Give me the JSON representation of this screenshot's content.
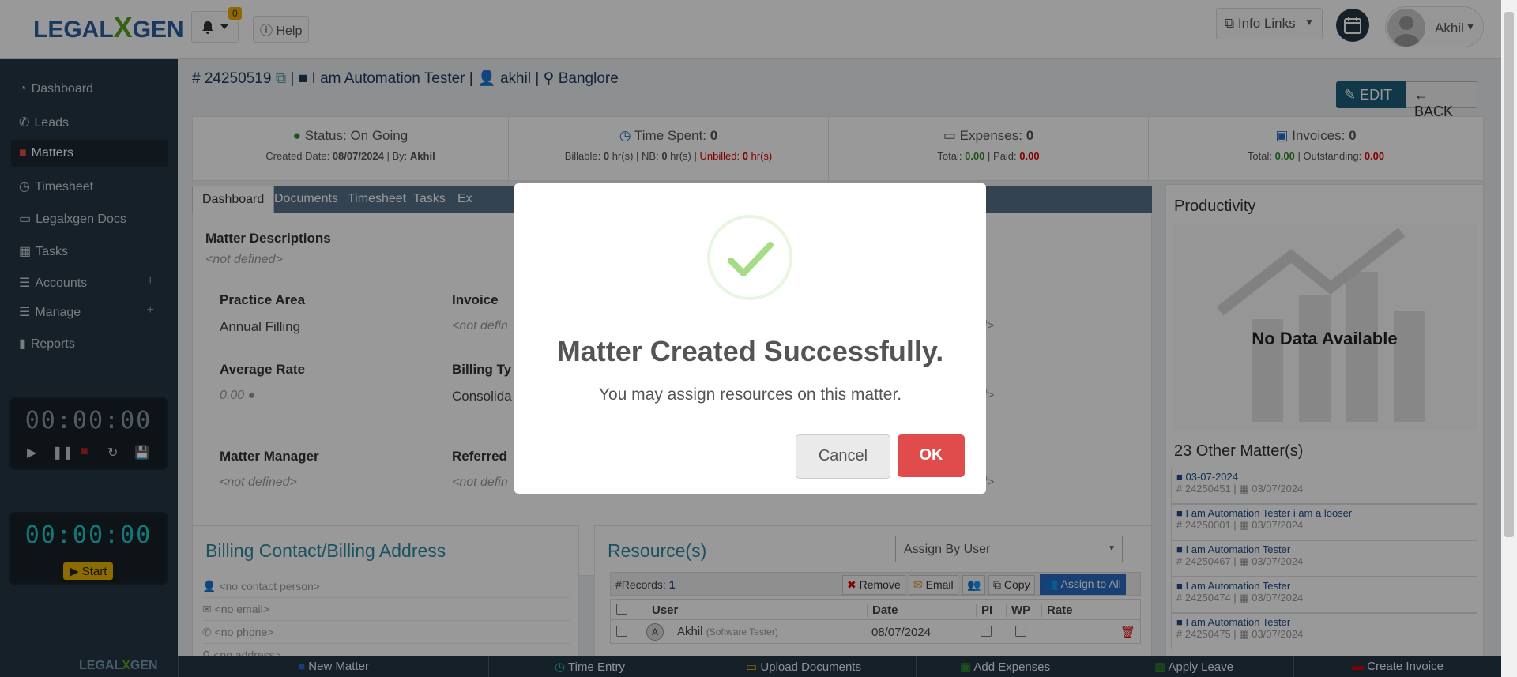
{
  "header": {
    "logo": {
      "left": "LEGAL",
      "mid": "X",
      "right": "GEN"
    },
    "notifications_count": "0",
    "help": "Help",
    "info_links": "Info Links",
    "user_name": "Akhil"
  },
  "sidebar": {
    "items": [
      {
        "label": "Dashboard",
        "icon": "dashboard-icon"
      },
      {
        "label": "Leads",
        "icon": "phone-icon"
      },
      {
        "label": "Matters",
        "icon": "briefcase-icon"
      },
      {
        "label": "Timesheet",
        "icon": "clock-icon"
      },
      {
        "label": "Legalxgen Docs",
        "icon": "folder-icon"
      },
      {
        "label": "Tasks",
        "icon": "calendar-icon"
      },
      {
        "label": "Accounts",
        "icon": "list-icon"
      },
      {
        "label": "Manage",
        "icon": "list-icon"
      },
      {
        "label": "Reports",
        "icon": "bar-chart-icon"
      }
    ],
    "timer1": "00:00:00",
    "timer2": "00:00:00",
    "start_label": "Start"
  },
  "matter": {
    "number": "24250519",
    "name": "I am Automation Tester",
    "user": "akhil",
    "location": "Banglore",
    "edit_label": "EDIT",
    "back_label": "BACK"
  },
  "stats": {
    "status": {
      "label": "Status: On Going",
      "created_pre": "Created Date: ",
      "created_date": "08/07/2024",
      "by_pre": " | By: ",
      "by": "Akhil"
    },
    "time": {
      "label": "Time Spent: ",
      "value": "0",
      "billable_pre": "Billable: ",
      "billable": "0",
      "billable_unit": " hr(s) | NB: ",
      "nb": "0",
      "nb_unit": " hr(s) | ",
      "unbilled_pre": "Unbilled: ",
      "unbilled": "0",
      "unbilled_unit": " hr(s)"
    },
    "expenses": {
      "label": "Expenses: ",
      "value": "0",
      "total_pre": "Total: ",
      "total": "0.00",
      "paid_pre": " | Paid: ",
      "paid": "0.00"
    },
    "invoices": {
      "label": "Invoices: ",
      "value": "0",
      "total_pre": "Total: ",
      "total": "0.00",
      "out_pre": " | Outstanding: ",
      "outstanding": "0.00"
    }
  },
  "tabs": [
    "Dashboard",
    "Documents",
    "Timesheet",
    "Tasks",
    "Ex"
  ],
  "dashboard": {
    "desc_label": "Matter Descriptions",
    "not_defined": "<not defined>",
    "practice_area_label": "Practice Area",
    "practice_area": "Annual Filling",
    "invoice_label": "Invoice",
    "invoice_value": "<not defin",
    "avg_rate_label": "Average Rate",
    "avg_rate": "0.00",
    "billing_type_label": "Billing Ty",
    "billing_type": "Consolida",
    "manager_label": "Matter Manager",
    "referred_label": "Referred",
    "referred_value": "<not defin",
    "right_nd": "d>"
  },
  "productivity": {
    "title": "Productivity",
    "no_data": "No Data Available",
    "other_title": "23 Other Matter(s)",
    "others": [
      {
        "name": "03-07-2024",
        "num": "24250451",
        "date": "03/07/2024"
      },
      {
        "name": "I am Automation Tester i am a looser",
        "num": "24250001",
        "date": "03/07/2024"
      },
      {
        "name": "I am Automation Tester",
        "num": "24250467",
        "date": "03/07/2024"
      },
      {
        "name": "I am Automation Tester",
        "num": "24250474",
        "date": "03/07/2024"
      },
      {
        "name": "I am Automation Tester",
        "num": "24250475",
        "date": "03/07/2024"
      }
    ]
  },
  "billing": {
    "title": "Billing Contact/Billing Address",
    "contact": "<no contact person>",
    "email": "<no email>",
    "phone": "<no phone>",
    "address": "<no address>"
  },
  "resources": {
    "title": "Resource(s)",
    "assign_select": "Assign By User",
    "records_label": "#Records: ",
    "records": "1",
    "remove": "Remove",
    "email": "Email",
    "copy": "Copy",
    "assign_all": "Assign to All",
    "columns": [
      "User",
      "Date",
      "PI",
      "WP",
      "Rate"
    ],
    "row": {
      "avatar": "A",
      "user": "Akhil",
      "role": "(Software Tester)",
      "date": "08/07/2024"
    }
  },
  "bottombar": [
    "New Matter",
    "Time Entry",
    "Upload Documents",
    "Add Expenses",
    "Apply Leave",
    "Create Invoice"
  ],
  "modal": {
    "title": "Matter Created Successfully.",
    "message": "You may assign resources on this matter.",
    "cancel": "Cancel",
    "ok": "OK"
  },
  "colors": {
    "sidebar": "#263645",
    "accent": "#1c5e7a",
    "ok": "#e04b4b",
    "success": "#a5dc86",
    "timer2": "#1ec8c8"
  }
}
